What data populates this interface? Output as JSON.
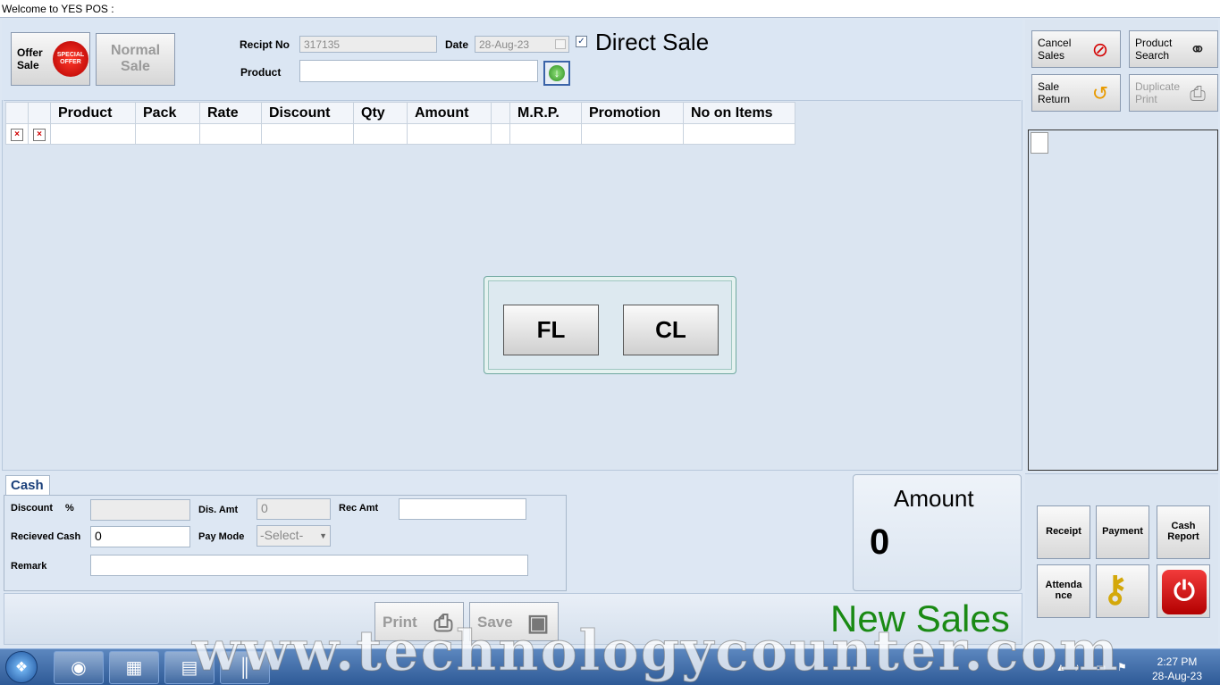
{
  "window": {
    "title": "Welcome to YES POS :"
  },
  "header": {
    "offer_sale_label_1": "Offer",
    "offer_sale_label_2": "Sale",
    "offer_badge_1": "SPECIAL",
    "offer_badge_2": "OFFER",
    "normal_sale_label_1": "Normal",
    "normal_sale_label_2": "Sale",
    "receipt_no_label": "Recipt No",
    "receipt_no_value": "317135",
    "date_label": "Date",
    "date_value": "28-Aug-23",
    "direct_sale_label": "Direct Sale",
    "direct_sale_checked": true,
    "checkmark": "✓",
    "product_label": "Product",
    "product_value": ""
  },
  "grid": {
    "columns": [
      "",
      "",
      "Product",
      "Pack",
      "Rate",
      "Discount",
      "Qty",
      "Amount",
      "",
      "M.R.P.",
      "Promotion",
      "No on Items"
    ],
    "row_delete_glyph": "×"
  },
  "liquor_type": {
    "fl_label": "FL",
    "cl_label": "CL"
  },
  "sidebar": {
    "cancel_sales_1": "Cancel",
    "cancel_sales_2": "Sales",
    "product_search_1": "Product",
    "product_search_2": "Search",
    "sale_return_1": "Sale",
    "sale_return_2": "Return",
    "duplicate_print_1": "Duplicate",
    "duplicate_print_2": "Print"
  },
  "cash": {
    "tab_label": "Cash",
    "discount_label": "Discount",
    "percent_label": "%",
    "discount_value": "",
    "dis_amt_label": "Dis. Amt",
    "dis_amt_value": "0",
    "rec_amt_label": "Rec Amt",
    "rec_amt_value": "",
    "received_cash_label": "Recieved Cash",
    "received_cash_value": "0",
    "pay_mode_label": "Pay Mode",
    "pay_mode_value": "-Select-",
    "remark_label": "Remark",
    "remark_value": ""
  },
  "amount": {
    "label": "Amount",
    "value": "0"
  },
  "footer": {
    "print_label": "Print",
    "save_label": "Save",
    "status": "New Sales"
  },
  "actions": {
    "receipt_label": "Receipt",
    "payment_label": "Payment",
    "cash_report_1": "Cash",
    "cash_report_2": "Report",
    "attendance_1": "Attenda",
    "attendance_2": "nce"
  },
  "taskbar": {
    "time": "2:27 PM",
    "date": "28-Aug-23",
    "tray_arrow": "▲"
  },
  "watermark": "www.technologycounter.com",
  "colors": {
    "status_green": "#1a8a14",
    "tab_blue": "#1a3f7a",
    "power_red": "#d01010"
  }
}
